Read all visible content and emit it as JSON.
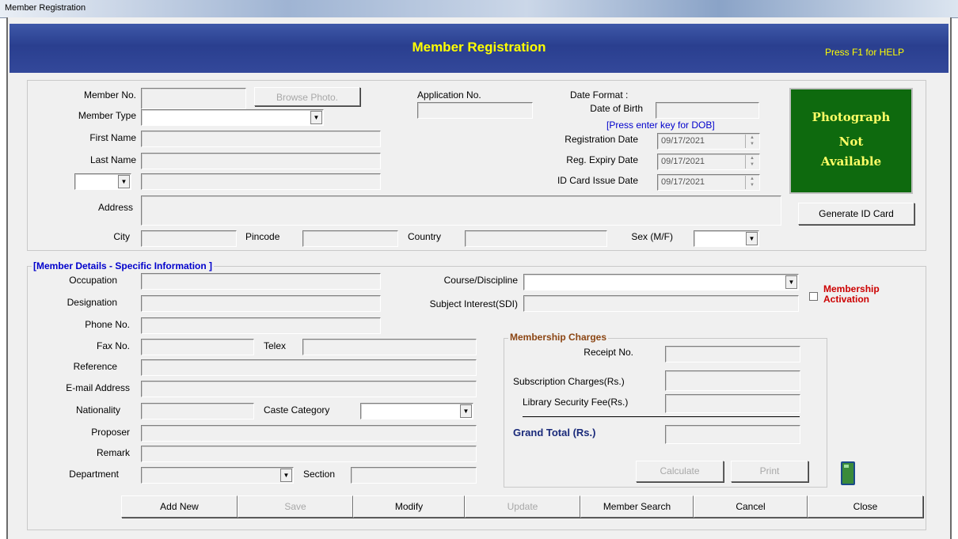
{
  "window": {
    "title": "Member Registration"
  },
  "banner": {
    "title": "Member Registration",
    "help": "Press F1 for HELP"
  },
  "top": {
    "member_no_label": "Member No.",
    "member_no_value": "",
    "browse_photo": "Browse Photo.",
    "member_type_label": "Member Type",
    "member_type_value": "",
    "first_name_label": "First Name",
    "last_name_label": "Last Name",
    "title_combo_value": "",
    "address_label": "Address",
    "city_label": "City",
    "pincode_label": "Pincode",
    "country_label": "Country",
    "sex_label": "Sex (M/F)",
    "sex_value": "",
    "application_no_label": "Application No.",
    "date_format_label": "Date Format :",
    "dob_label": "Date of Birth",
    "dob_hint": "[Press enter key for DOB]",
    "reg_date_label": "Registration Date",
    "reg_date_value": "09/17/2021",
    "reg_expiry_label": "Reg. Expiry Date",
    "reg_expiry_value": "09/17/2021",
    "id_card_issue_label": "ID Card Issue Date",
    "id_card_issue_value": "09/17/2021",
    "photo_line1": "Photograph",
    "photo_line2": "Not",
    "photo_line3": "Available",
    "generate_id_card": "Generate ID Card"
  },
  "details": {
    "legend": "[Member Details - Specific Information ]",
    "occupation_label": "Occupation",
    "designation_label": "Designation",
    "phone_label": "Phone No.",
    "fax_label": "Fax No.",
    "telex_label": "Telex",
    "reference_label": "Reference",
    "email_label": "E-mail Address",
    "nationality_label": "Nationality",
    "caste_label": "Caste Category",
    "proposer_label": "Proposer",
    "remark_label": "Remark",
    "department_label": "Department",
    "section_label": "Section",
    "course_label": "Course/Discipline",
    "subject_label": "Subject Interest(SDI)",
    "membership_activation": "Membership Activation"
  },
  "charges": {
    "legend": "Membership Charges",
    "receipt_label": "Receipt No.",
    "subscription_label": "Subscription Charges(Rs.)",
    "security_label": "Library Security Fee(Rs.)",
    "grand_total_label": "Grand Total (Rs.)",
    "calculate": "Calculate",
    "print": "Print"
  },
  "toolbar": {
    "add_new": "Add New",
    "save": "Save",
    "modify": "Modify",
    "update": "Update",
    "member_search": "Member Search",
    "cancel": "Cancel",
    "close": "Close"
  },
  "colors": {
    "banner": "#2a3f8f",
    "banner_text": "#ffff00",
    "label_blue": "#0000cc",
    "activation_red": "#cc0000",
    "photo_bg": "#0e6a0e"
  },
  "icons": {
    "calculator": "calculator-icon",
    "dropdown": "chevron-down-icon"
  }
}
